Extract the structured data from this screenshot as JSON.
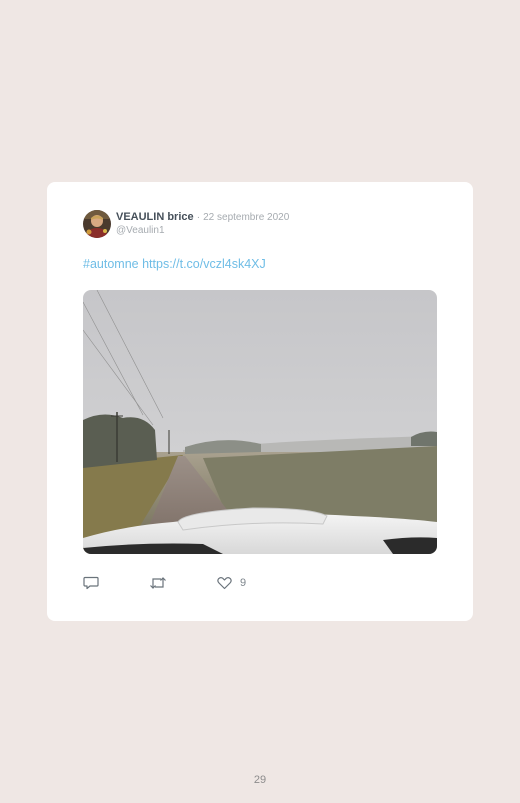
{
  "tweet": {
    "display_name": "VEAULIN brice",
    "separator": "·",
    "date": "22 septembre 2020",
    "handle": "@Veaulin1",
    "hashtag": "#automne",
    "link": "https://t.co/vczl4sk4XJ",
    "like_count": "9"
  },
  "icons": {
    "reply": "reply-icon",
    "retweet": "retweet-icon",
    "like": "heart-icon"
  },
  "colors": {
    "background": "#efe7e4",
    "card": "#ffffff",
    "link": "#6fbde6",
    "muted": "#a6abb0"
  },
  "page": {
    "number": "29"
  }
}
